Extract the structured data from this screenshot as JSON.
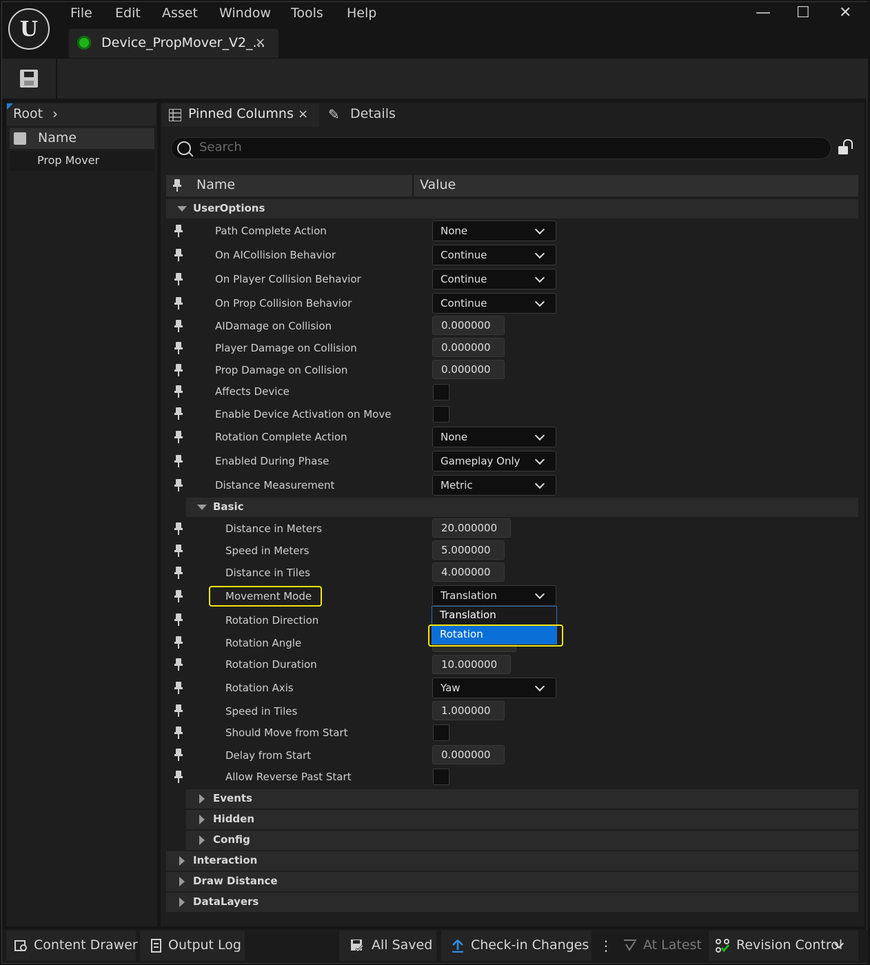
{
  "menu": [
    "File",
    "Edit",
    "Asset",
    "Window",
    "Tools",
    "Help"
  ],
  "window_controls": {
    "minimize": "—",
    "maximize": "☐",
    "close": "✕"
  },
  "logo_text": "U",
  "doc_tab": {
    "label": "Device_PropMover_V2_...",
    "close": "×"
  },
  "left_panel": {
    "breadcrumb": "Root",
    "breadcrumb_chevron": "›",
    "header": "Name",
    "rows": [
      "Prop Mover"
    ]
  },
  "tabs": {
    "pinned": {
      "label": "Pinned Columns",
      "close": "×"
    },
    "details": {
      "label": "Details"
    }
  },
  "search": {
    "placeholder": "Search"
  },
  "columns": {
    "name": "Name",
    "value": "Value"
  },
  "categories": {
    "user_options": "UserOptions",
    "basic": "Basic",
    "events": "Events",
    "hidden": "Hidden",
    "config": "Config",
    "interaction": "Interaction",
    "draw_distance": "Draw Distance",
    "data_layers": "DataLayers"
  },
  "user_options_props": [
    {
      "label": "Path Complete Action",
      "type": "combo",
      "value": "None"
    },
    {
      "label": "On AICollision Behavior",
      "type": "combo",
      "value": "Continue"
    },
    {
      "label": "On Player Collision Behavior",
      "type": "combo",
      "value": "Continue"
    },
    {
      "label": "On Prop Collision Behavior",
      "type": "combo",
      "value": "Continue"
    },
    {
      "label": "AIDamage on Collision",
      "type": "number",
      "value": "0.000000"
    },
    {
      "label": "Player Damage on Collision",
      "type": "number",
      "value": "0.000000"
    },
    {
      "label": "Prop Damage on Collision",
      "type": "number",
      "value": "0.000000"
    },
    {
      "label": "Affects Device",
      "type": "checkbox",
      "checked": false
    },
    {
      "label": "Enable Device Activation on Move",
      "type": "checkbox",
      "checked": false
    },
    {
      "label": "Rotation Complete Action",
      "type": "combo",
      "value": "None"
    },
    {
      "label": "Enabled During Phase",
      "type": "combo",
      "value": "Gameplay Only"
    },
    {
      "label": "Distance Measurement",
      "type": "combo",
      "value": "Metric"
    }
  ],
  "basic_props": [
    {
      "label": "Distance in Meters",
      "type": "number",
      "value": "20.000000"
    },
    {
      "label": "Speed in Meters",
      "type": "number",
      "value": "5.000000"
    },
    {
      "label": "Distance in Tiles",
      "type": "number",
      "value": "4.000000"
    },
    {
      "label": "Movement Mode",
      "type": "combo",
      "value": "Translation"
    },
    {
      "label": "Rotation Direction",
      "type": "combo",
      "value": ""
    },
    {
      "label": "Rotation Angle",
      "type": "number",
      "value": ""
    },
    {
      "label": "Rotation Duration",
      "type": "number",
      "value": "10.000000"
    },
    {
      "label": "Rotation Axis",
      "type": "combo",
      "value": "Yaw"
    },
    {
      "label": "Speed in Tiles",
      "type": "number",
      "value": "1.000000"
    },
    {
      "label": "Should Move from Start",
      "type": "checkbox",
      "checked": false
    },
    {
      "label": "Delay from Start",
      "type": "number",
      "value": "0.000000"
    },
    {
      "label": "Allow Reverse Past Start",
      "type": "checkbox",
      "checked": false
    }
  ],
  "dropdown": {
    "options": [
      "Translation",
      "Rotation"
    ],
    "hovered": "Rotation"
  },
  "statusbar": {
    "content_drawer": "Content Drawer",
    "output_log": "Output Log",
    "all_saved": "All Saved",
    "check_in": "Check-in Changes",
    "more": "⋮",
    "at_latest": "At Latest",
    "revision_control": "Revision Control"
  },
  "colors": {
    "accent_blue": "#0a6fd6",
    "highlight_yellow": "#f5e40a",
    "status_green": "#21b21b"
  }
}
